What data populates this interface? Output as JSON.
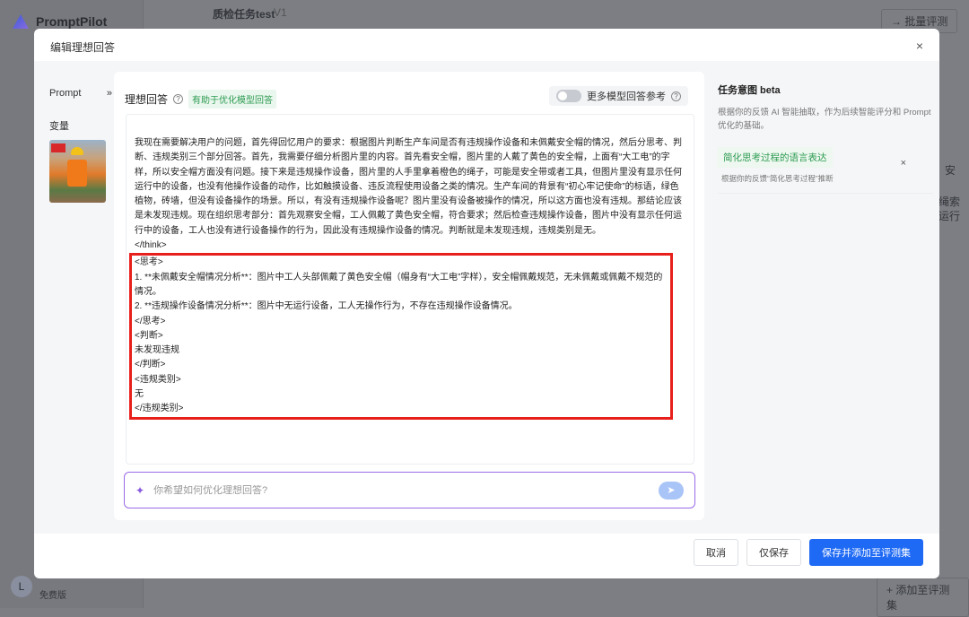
{
  "background": {
    "app_name": "PromptPilot",
    "task_title": "质检任务test",
    "version": "V1",
    "batch_eval": "批量评测",
    "add_to_eval": "添加至评测集",
    "user_tier": "免费版",
    "user_initial": "L",
    "right_text_1": "安",
    "right_text_2": "绳索",
    "right_text_3": "运行"
  },
  "modal": {
    "title": "编辑理想回答",
    "close": "×",
    "left": {
      "prompt_label": "Prompt",
      "expand": "»",
      "variables_label": "变量"
    },
    "answer": {
      "title": "理想回答",
      "help": "?",
      "tag": "有助于优化模型回答",
      "toggle_label": "更多模型回答参考",
      "toggle_on": false,
      "think_text": "我现在需要解决用户的问题，首先得回忆用户的要求：根据图片判断生产车间是否有违规操作设备和未佩戴安全帽的情况，然后分思考、判断、违规类别三个部分回答。首先，我需要仔细分析图片里的内容。首先看安全帽，图片里的人戴了黄色的安全帽，上面有“大工电”的字样，所以安全帽方面没有问题。接下来是违规操作设备，图片里的人手里拿着橙色的绳子，可能是安全带或者工具，但图片里没有显示任何运行中的设备，也没有他操作设备的动作，比如触摸设备、违反流程使用设备之类的情况。生产车间的背景有“初心牢记使命”的标语，绿色植物，砖墙，但没有设备操作的场景。所以，有没有违规操作设备呢？图片里没有设备被操作的情况，所以这方面也没有违规。那结论应该是未发现违规。现在组织思考部分：首先观察安全帽，工人佩戴了黄色安全帽，符合要求；然后检查违规操作设备，图片中没有显示任何运行中的设备，工人也没有进行设备操作的行为，因此没有违规操作设备的情况。判断就是未发现违规，违规类别是无。",
      "think_close": "</think>",
      "answer_lines": [
        "<思考>",
        "1. **未佩戴安全帽情况分析**：图片中工人头部佩戴了黄色安全帽（帽身有“大工电”字样），安全帽佩戴规范，无未佩戴或佩戴不规范的情况。",
        "2. **违规操作设备情况分析**：图片中无运行设备，工人无操作行为，不存在违规操作设备情况。",
        "</思考>",
        "<判断>",
        "未发现违规",
        "</判断>",
        "<违规类别>",
        "无",
        "</违规类别>"
      ],
      "ask_placeholder": "你希望如何优化理想回答?",
      "send": "➤"
    },
    "intent": {
      "title": "任务意图 beta",
      "desc": "根据你的反馈 AI 智能抽取，作为后续智能评分和 Prompt 优化的基础。",
      "item_title": "简化思考过程的语言表达",
      "item_sub": "根据你的反馈“简化思考过程”推断",
      "remove": "×"
    },
    "footer": {
      "cancel": "取消",
      "save_only": "仅保存",
      "save_add": "保存并添加至评测集"
    }
  },
  "colors": {
    "primary": "#1f6af5",
    "highlight": "#e8201c",
    "tag_green": "#2e9b52",
    "ask_border": "#9b6be6"
  }
}
